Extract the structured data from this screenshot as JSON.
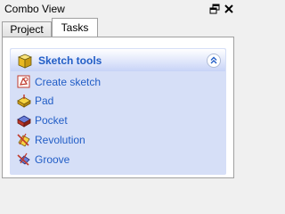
{
  "window": {
    "title": "Combo View"
  },
  "tabs": [
    {
      "label": "Project",
      "active": false
    },
    {
      "label": "Tasks",
      "active": true
    }
  ],
  "task_panel": {
    "header": {
      "title": "Sketch tools",
      "icon": "sketch-cube-icon"
    },
    "items": [
      {
        "label": "Create sketch",
        "icon": "create-sketch-icon"
      },
      {
        "label": "Pad",
        "icon": "pad-icon"
      },
      {
        "label": "Pocket",
        "icon": "pocket-icon"
      },
      {
        "label": "Revolution",
        "icon": "revolution-icon"
      },
      {
        "label": "Groove",
        "icon": "groove-icon"
      }
    ]
  },
  "colors": {
    "link": "#215dc6",
    "panel_background": "#d6dff7",
    "header_gradient_end": "#c7d3f7"
  }
}
